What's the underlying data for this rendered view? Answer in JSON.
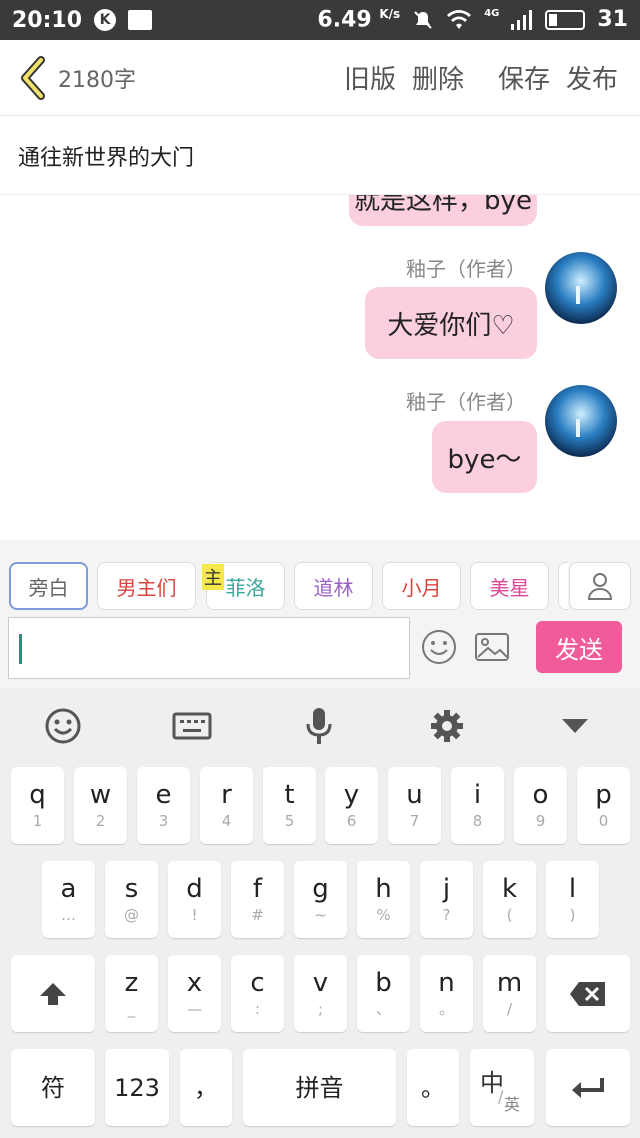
{
  "status_bar": {
    "time": "20:10",
    "speed": "6.49",
    "speed_unit": "K/s",
    "network": "4G",
    "battery": "31"
  },
  "header": {
    "word_count": "2180字",
    "old_version": "旧版",
    "delete": "删除",
    "save": "保存",
    "publish": "发布"
  },
  "chapter_title": "通往新世界的大门",
  "messages": [
    {
      "text": "就是这样，bye"
    },
    {
      "speaker": "釉子（作者）",
      "text": "大爱你们♡"
    },
    {
      "speaker": "釉子（作者）",
      "text": "bye～"
    }
  ],
  "roles": [
    {
      "label": "旁白",
      "color": "#666666"
    },
    {
      "label": "男主们",
      "color": "#d9453f"
    },
    {
      "label": "菲洛",
      "color": "#3aa79b"
    },
    {
      "label": "道林",
      "color": "#9a62c4"
    },
    {
      "label": "小月",
      "color": "#d9453f"
    },
    {
      "label": "美星",
      "color": "#e0479a"
    }
  ],
  "main_tag": "主",
  "input": {
    "value": ""
  },
  "send_label": "发送",
  "keyboard": {
    "row1": [
      {
        "main": "q",
        "sub": "1"
      },
      {
        "main": "w",
        "sub": "2"
      },
      {
        "main": "e",
        "sub": "3"
      },
      {
        "main": "r",
        "sub": "4"
      },
      {
        "main": "t",
        "sub": "5"
      },
      {
        "main": "y",
        "sub": "6"
      },
      {
        "main": "u",
        "sub": "7"
      },
      {
        "main": "i",
        "sub": "8"
      },
      {
        "main": "o",
        "sub": "9"
      },
      {
        "main": "p",
        "sub": "0"
      }
    ],
    "row2": [
      {
        "main": "a",
        "sub": "…"
      },
      {
        "main": "s",
        "sub": "@"
      },
      {
        "main": "d",
        "sub": "!"
      },
      {
        "main": "f",
        "sub": "#"
      },
      {
        "main": "g",
        "sub": "~"
      },
      {
        "main": "h",
        "sub": "%"
      },
      {
        "main": "j",
        "sub": "?"
      },
      {
        "main": "k",
        "sub": "("
      },
      {
        "main": "l",
        "sub": ")"
      }
    ],
    "row3": [
      {
        "main": "z",
        "sub": "_"
      },
      {
        "main": "x",
        "sub": "—"
      },
      {
        "main": "c",
        "sub": ":"
      },
      {
        "main": "v",
        "sub": ";"
      },
      {
        "main": "b",
        "sub": "、"
      },
      {
        "main": "n",
        "sub": "。"
      },
      {
        "main": "m",
        "sub": "/"
      }
    ],
    "symbol": "符",
    "num": "123",
    "comma": "，",
    "space": "拼音",
    "period": "。",
    "lang_main": "中",
    "lang_sub": "英"
  }
}
